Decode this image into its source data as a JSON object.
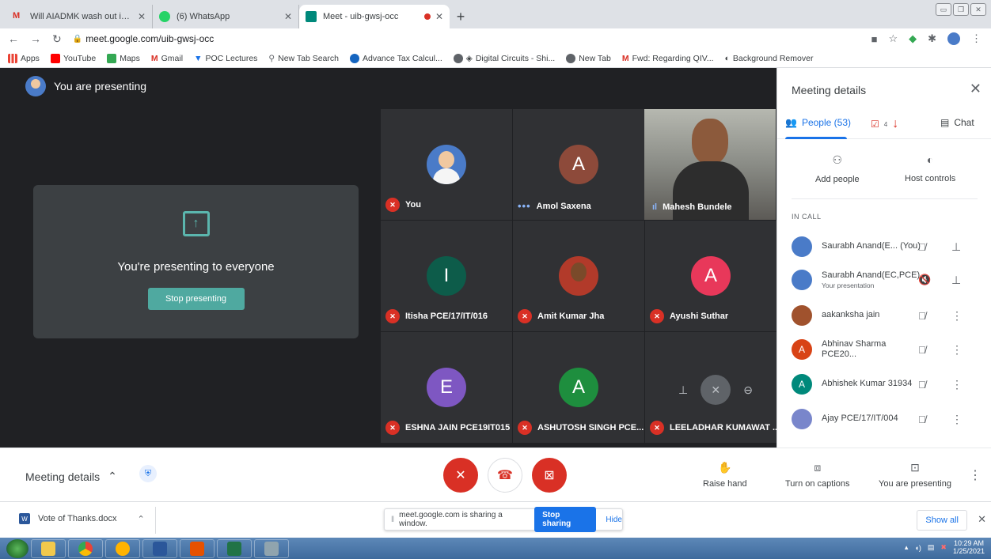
{
  "browser": {
    "tabs": [
      {
        "title": "Will AIADMK wash out in the ass…",
        "close": "✕"
      },
      {
        "title": "(6) WhatsApp",
        "close": "✕"
      },
      {
        "title": "Meet - uib-gwsj-occ",
        "close": "✕"
      }
    ],
    "new_tab": "+",
    "url": "meet.google.com/uib-gwsj-occ",
    "bookmarks": [
      "Apps",
      "YouTube",
      "Maps",
      "Gmail",
      "POC Lectures",
      "New Tab Search",
      "Advance Tax Calcul...",
      "Digital Circuits - Shi...",
      "New Tab",
      "Fwd: Regarding QIV...",
      "Background Remover"
    ]
  },
  "meet": {
    "presenting_banner": "You are presenting",
    "present_message": "You're presenting to everyone",
    "stop_presenting": "Stop presenting",
    "tiles": [
      {
        "name": "You",
        "initial": "",
        "color": "#4a7bc8",
        "status": "muted"
      },
      {
        "name": "Amol Saxena",
        "initial": "A",
        "color": "#8d4a3a",
        "status": "speaking-dots"
      },
      {
        "name": "Mahesh Bundele",
        "initial": "",
        "color": "",
        "status": "speaking"
      },
      {
        "name": "Itisha PCE/17/IT/016",
        "initial": "I",
        "color": "#0d5c4a",
        "status": "muted"
      },
      {
        "name": "Amit Kumar Jha",
        "initial": "",
        "color": "#b23a2a",
        "status": "muted"
      },
      {
        "name": "Ayushi Suthar",
        "initial": "A",
        "color": "#e8385a",
        "status": "muted"
      },
      {
        "name": "ESHNA JAIN PCE19IT015",
        "initial": "E",
        "color": "#7e57c2",
        "status": "muted"
      },
      {
        "name": "ASHUTOSH SINGH PCE...",
        "initial": "A",
        "color": "#1e8e3e",
        "status": "muted"
      },
      {
        "name": "LEELADHAR KUMAWAT ...",
        "initial": "",
        "color": "",
        "status": "muted"
      }
    ]
  },
  "panel": {
    "title": "Meeting details",
    "close": "✕",
    "tab_people": "People (53)",
    "tab_badge": "4",
    "tab_chat": "Chat",
    "add_people": "Add people",
    "host_controls": "Host controls",
    "in_call": "IN CALL",
    "people": [
      {
        "name": "Saurabh Anand(E...",
        "suffix": "(You)",
        "sub": "",
        "initial": "",
        "color": "#4a7bc8"
      },
      {
        "name": "Saurabh Anand(EC,PCE)",
        "suffix": "",
        "sub": "Your presentation",
        "initial": "",
        "color": "#4a7bc8"
      },
      {
        "name": "aakanksha jain",
        "suffix": "",
        "sub": "",
        "initial": "",
        "color": "#a0522d"
      },
      {
        "name": "Abhinav Sharma PCE20...",
        "suffix": "",
        "sub": "",
        "initial": "A",
        "color": "#d84315"
      },
      {
        "name": "Abhishek Kumar 31934",
        "suffix": "",
        "sub": "",
        "initial": "A",
        "color": "#00897b"
      },
      {
        "name": "Ajay PCE/17/IT/004",
        "suffix": "",
        "sub": "",
        "initial": "",
        "color": "#7986cb"
      }
    ]
  },
  "bottom": {
    "meeting_details": "Meeting details",
    "raise_hand": "Raise hand",
    "captions": "Turn on captions",
    "you_presenting": "You are presenting"
  },
  "downloads": {
    "file": "Vote of Thanks.docx",
    "share_msg": "meet.google.com is sharing a window.",
    "stop_sharing": "Stop sharing",
    "hide": "Hide",
    "show_all": "Show all"
  },
  "taskbar": {
    "time": "10:29 AM",
    "date": "1/25/2021"
  }
}
